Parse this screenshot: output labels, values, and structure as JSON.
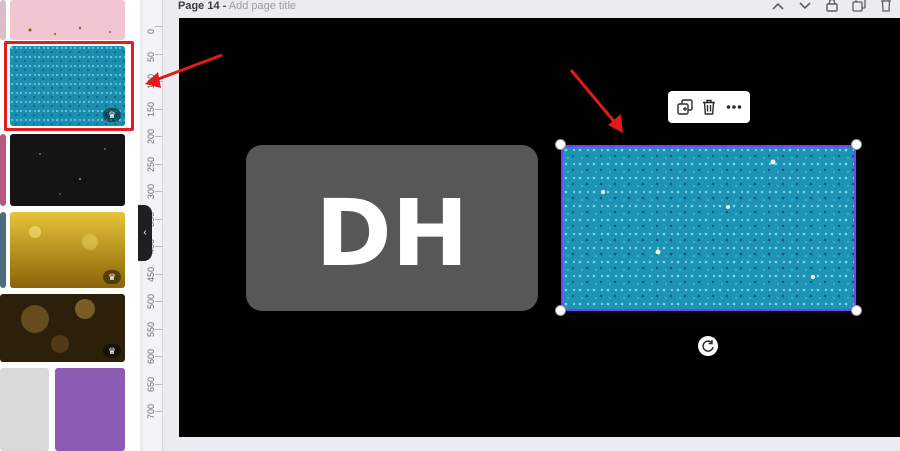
{
  "header": {
    "page_label": "Page 14 -",
    "title_placeholder": "Add page title",
    "actions": [
      {
        "name": "collapse-page-icon"
      },
      {
        "name": "expand-page-icon"
      },
      {
        "name": "lock-icon"
      },
      {
        "name": "duplicate-page-icon"
      },
      {
        "name": "delete-page-icon"
      }
    ]
  },
  "ruler": {
    "labels": [
      "0",
      "50",
      "100",
      "150",
      "200",
      "250",
      "300",
      "350",
      "400",
      "450",
      "500",
      "550",
      "600",
      "650",
      "700"
    ]
  },
  "canvas": {
    "background": "#000000",
    "logo_text": "DH",
    "logo_card_color": "#575757",
    "selection_color": "#7d3cff",
    "glitter_color": "#2aa6c8"
  },
  "element_toolbar": {
    "items": [
      {
        "name": "duplicate-icon"
      },
      {
        "name": "trash-icon"
      },
      {
        "name": "more-options-icon"
      }
    ]
  },
  "sidebar": {
    "thumbnails": [
      {
        "name": "pink-glitter-thumbnail",
        "color": "#f1c6d0",
        "premium": false
      },
      {
        "name": "blue-glitter-thumbnail",
        "color": "#1f9fc0",
        "premium": true,
        "selected": true
      },
      {
        "name": "black-glitter-thumbnail",
        "color": "#141414",
        "premium": false
      },
      {
        "name": "gold-glitter-thumbnail",
        "color": "#c49a12",
        "premium": true
      },
      {
        "name": "gold-bokeh-thumbnail",
        "color": "#3b2a0f",
        "premium": true
      },
      {
        "name": "silver-glitter-thumbnail",
        "color": "#d9d9d9",
        "premium": false
      },
      {
        "name": "purple-glitter-thumbnail",
        "color": "#8d5bb3",
        "premium": false
      }
    ],
    "premium_badge": "♛",
    "collapse_glyph": "‹"
  },
  "annotation_color": "#e01b1b"
}
